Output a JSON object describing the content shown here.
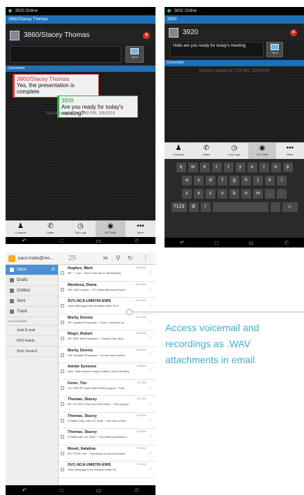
{
  "caption": {
    "lines": [
      "Access voicemail and",
      "recordings as .WAV",
      "attachments in email"
    ]
  },
  "chat1": {
    "status_text": "3920 Online",
    "title_text": "3860/Stacey Thomas",
    "contact_name": "3860/Stacey Thomas",
    "send_label": "Send",
    "connected_label": "Connected",
    "messages": [
      {
        "sender": "3860/Stacey Thomas",
        "text_line1": "Yes, the presentation is",
        "text_line2": "complete."
      },
      {
        "sender": "3939",
        "text_line1": "Are you ready for today's",
        "text_line2": "meeting?"
      }
    ],
    "session_text": "Session started at 3:59 PM, 3/6/2014",
    "nav": [
      "Contacts",
      "Dialer",
      "Call Logs",
      "UC Suite",
      "More"
    ]
  },
  "chat2": {
    "status_text": "3832 Online",
    "title_text": "3920",
    "contact_name": "3920",
    "input_text": "Hello are you ready for today's meeting",
    "send_label": "Send",
    "connected_label": "Connected",
    "session_text": "Session started at 7:52 AM, 11/4/2014",
    "nav": [
      "Contacts",
      "Dialer",
      "Call Logs",
      "UC Suite",
      "More"
    ],
    "keyboard": {
      "row1": [
        "q",
        "w",
        "e",
        "r",
        "t",
        "y",
        "u",
        "i",
        "o",
        "p"
      ],
      "row2": [
        "a",
        "s",
        "d",
        "f",
        "g",
        "h",
        "j",
        "k",
        "l"
      ],
      "row3": [
        "z",
        "x",
        "c",
        "v",
        "b",
        "n",
        "m",
        ",",
        "."
      ],
      "row4_left": "?123",
      "row4_slash": "/"
    }
  },
  "email": {
    "account": "paul.maite@res...",
    "count": "25",
    "folders": [
      {
        "label": "Inbox",
        "count": "25"
      },
      {
        "label": "Drafts"
      },
      {
        "label": "Outbox"
      },
      {
        "label": "Sent"
      },
      {
        "label": "Trash"
      }
    ],
    "section_label": "ALL FOLDERS",
    "subfolders": [
      "Junk E-mail",
      "RSS Feeds",
      "Sync Issues1"
    ],
    "messages": [
      {
        "from": "Hughes, Mark",
        "time": "10:23 AM",
        "subject": "RE: ~ I am... Sure it will call on Wednesday"
      },
      {
        "from": "Mendoza, Diana",
        "time": "10:19 AM",
        "subject": "FW: MES Labors ~ FYI Diana Mendoza Export"
      },
      {
        "from": "SVC-NCA-UM6700-EWS",
        "time": "10:13 AM",
        "subject": "Voice Message from Donalds Keller Tel 5"
      },
      {
        "from": "Bierly, Dennis",
        "time": "10:11 AM",
        "subject": "RE: Updated Proposals ~ Chas: I will work on"
      },
      {
        "from": "Mogri, Robert",
        "time": "10:05 AM",
        "subject": "RE: EBS Team Question ~ Thanks Paul: Bob"
      },
      {
        "from": "Bierly, Dennis",
        "time": "10:02 AM",
        "subject": "FW: Updated Proposals ~ Do we have anyone"
      },
      {
        "from": "Adobe Systems",
        "time": "9:58 AM",
        "subject": "New: Share assets using Creative Cloud Libraries"
      },
      {
        "from": "Fenix, Tim",
        "time": "9:51 AM",
        "subject": "SL7 ISB OP Track Multi Profile support ~ Paul"
      },
      {
        "from": "Thomas, Stacey",
        "time": "9:47 AM",
        "subject": "RE: UT7000 Track Info Sets Sheet ~ This is good"
      },
      {
        "from": "Thomas, Stacey",
        "time": "9:40 AM",
        "subject": "UT8800 Video with UC Suite ~ The new UT800"
      },
      {
        "from": "Thomas, Stacey",
        "time": "9:36 AM",
        "subject": "UT8800 with UC Suite ~ I am looking forward to"
      },
      {
        "from": "Mosel, Natalina",
        "time": "9:30 AM",
        "subject": "RE: PSTN Line ~ Thank you for your comment"
      },
      {
        "from": "SVC-NCA-UM6700-EWS",
        "time": "9:25 AM",
        "subject": "Voice Message from Donalds Keller Tel"
      }
    ]
  }
}
